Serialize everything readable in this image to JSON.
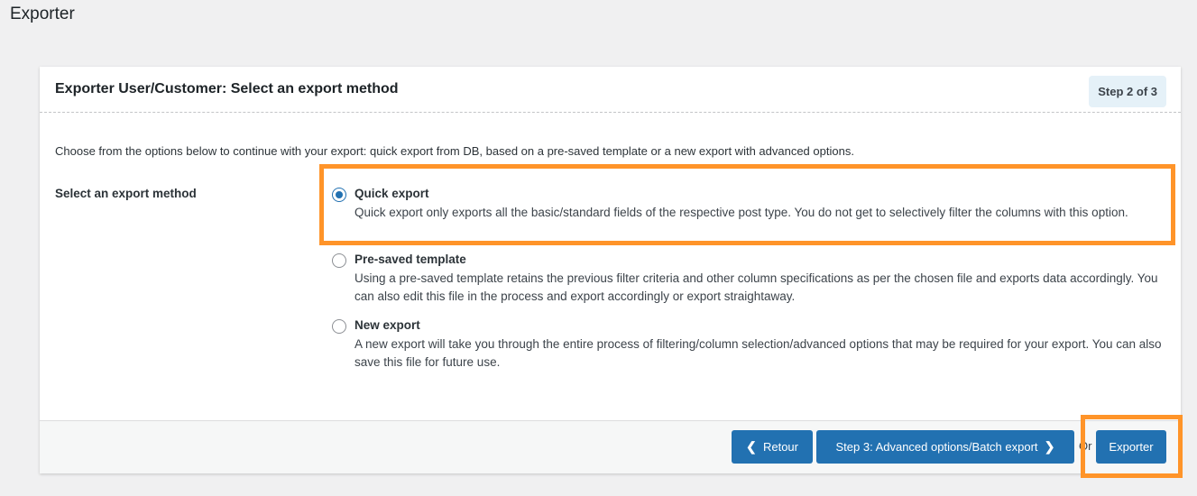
{
  "page": {
    "title": "Exporter"
  },
  "panel": {
    "title": "Exporter User/Customer: Select an export method",
    "step_badge": "Step 2 of 3",
    "intro": "Choose from the options below to continue with your export: quick export from DB, based on a pre-saved template or a new export with advanced options.",
    "field_label": "Select an export method"
  },
  "options": [
    {
      "title": "Quick export",
      "desc": "Quick export only exports all the basic/standard fields of the respective post type. You do not get to selectively filter the columns with this option.",
      "checked": true
    },
    {
      "title": "Pre-saved template",
      "desc": "Using a pre-saved template retains the previous filter criteria and other column specifications as per the chosen file and exports data accordingly. You can also edit this file in the process and export accordingly or export straightaway.",
      "checked": false
    },
    {
      "title": "New export",
      "desc": "A new export will take you through the entire process of filtering/column selection/advanced options that may be required for your export. You can also save this file for future use.",
      "checked": false
    }
  ],
  "footer": {
    "back_label": "Retour",
    "back_icon": "chevron-left-icon",
    "step3_label": "Step 3: Advanced options/Batch export",
    "step3_icon": "chevron-right-icon",
    "or_text": "Or",
    "export_label": "Exporter"
  },
  "colors": {
    "accent": "#2271b1",
    "highlight": "#ff9429",
    "badge_bg": "#e5f1f8"
  }
}
